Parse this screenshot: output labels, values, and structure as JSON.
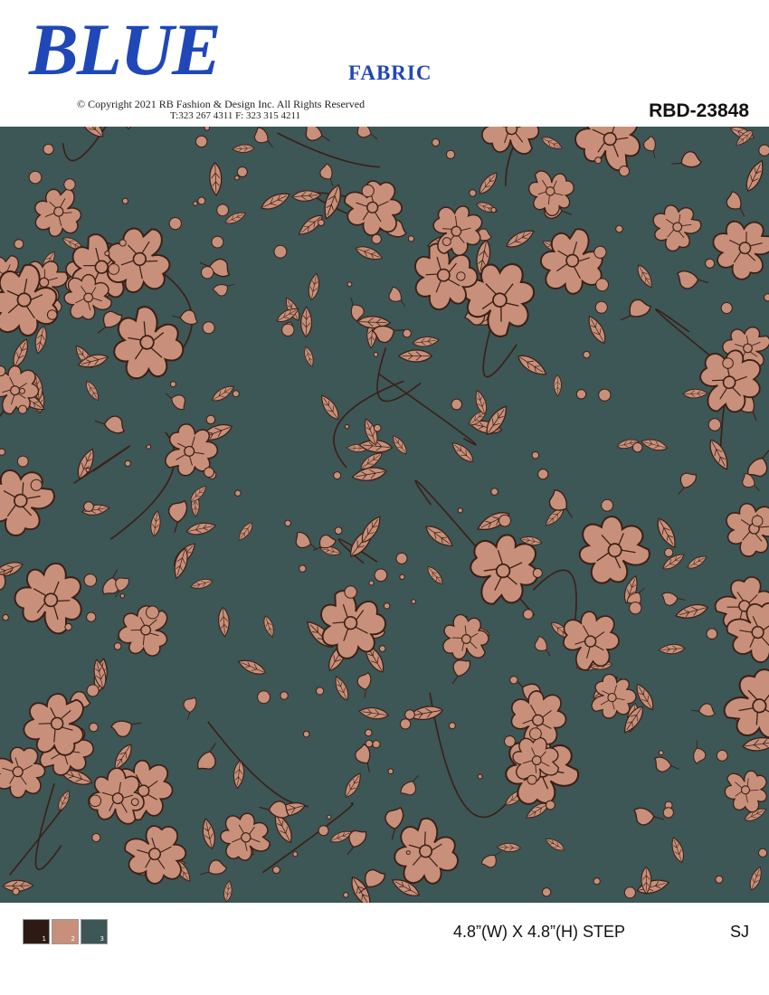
{
  "header": {
    "logo_text": "BLUE",
    "logo_sub": "FABRIC",
    "copyright": "© Copyright  2021  RB  Fashion & Design  Inc. All Rights Reserved",
    "contact": "T:323 267 4311   F: 323 315 4211",
    "design_code": "RBD-23848"
  },
  "pattern": {
    "background_color": "#3d5656",
    "motif_color": "#c8907a",
    "outline_color": "#3b1f16",
    "description_icon": "floral-pattern"
  },
  "footer": {
    "swatches": [
      {
        "number": "1",
        "color": "#2e1a15"
      },
      {
        "number": "2",
        "color": "#c8907a"
      },
      {
        "number": "3",
        "color": "#3d5656"
      }
    ],
    "step": "4.8”(W)  X  4.8”(H)  STEP",
    "designer": "SJ"
  }
}
